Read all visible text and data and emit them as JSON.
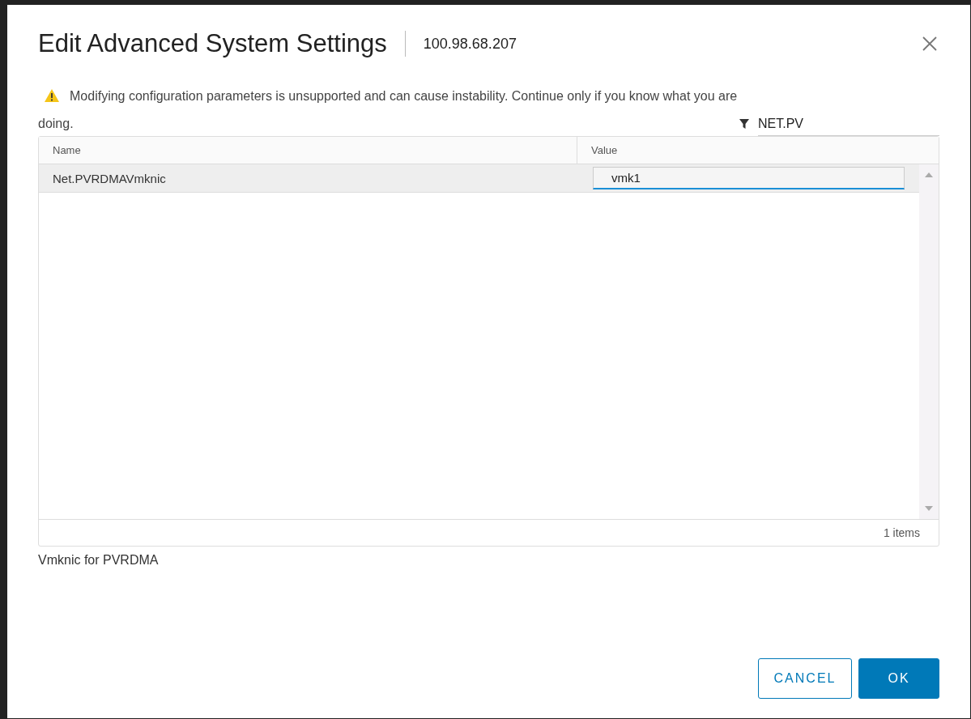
{
  "dialog": {
    "title": "Edit Advanced System Settings",
    "host": "100.98.68.207"
  },
  "warning": "Modifying configuration parameters is unsupported and can cause instability. Continue only if you know what you are doing.",
  "filter": {
    "value": "NET.PV"
  },
  "table": {
    "columns": [
      "Name",
      "Value"
    ],
    "rows": [
      {
        "name": "Net.PVRDMAVmknic",
        "value": "vmk1",
        "selected": true,
        "editing": true
      }
    ],
    "footer": "1 items"
  },
  "description": "Vmknic for PVRDMA",
  "buttons": [
    {
      "label": "CANCEL",
      "kind": "secondary"
    },
    {
      "label": "OK",
      "kind": "primary"
    }
  ]
}
